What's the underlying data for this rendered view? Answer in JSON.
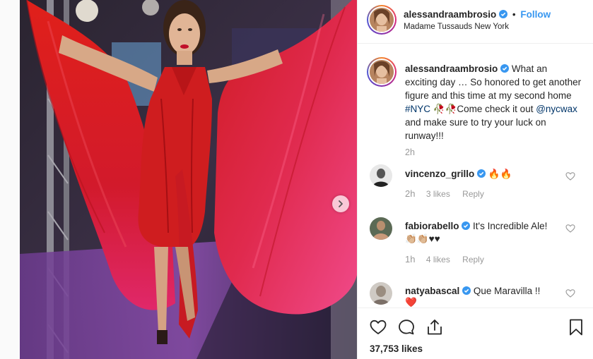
{
  "header": {
    "username": "alessandraambrosio",
    "separator": "•",
    "follow_label": "Follow",
    "location": "Madame Tussauds New York"
  },
  "caption": {
    "username": "alessandraambrosio",
    "text_part1": "What an exciting day … So honored to get another figure and this time at my second home ",
    "hashtag": "#NYC",
    "emoji_roses": "🥀🥀",
    "text_part2": "Come check it out ",
    "mention": "@nycwax",
    "text_part3": " and make sure to try your luck on runway!!!",
    "time": "2h"
  },
  "comments": [
    {
      "username": "vincenzo_grillo",
      "text": "🔥🔥",
      "time": "2h",
      "likes": "3 likes",
      "reply": "Reply"
    },
    {
      "username": "fabiorabello",
      "text": "It's Incredible Ale!",
      "text_line2": "👏🏼👏🏼♥♥",
      "time": "1h",
      "likes": "4 likes",
      "reply": "Reply"
    },
    {
      "username": "natyabascal",
      "text": "Que Maravilla !!",
      "text_line2": "❤️"
    }
  ],
  "likes_count": "37,753 likes",
  "icons": {
    "verified": "verified-badge-icon",
    "like": "heart-icon",
    "comment": "comment-bubble-icon",
    "share": "share-icon",
    "save": "bookmark-icon",
    "next": "chevron-right-icon"
  },
  "colors": {
    "accent": "#3897f0",
    "verified": "#3897f0",
    "dress": "#d8201c",
    "muted_text": "#999999",
    "heart_red": "#ed4956"
  }
}
